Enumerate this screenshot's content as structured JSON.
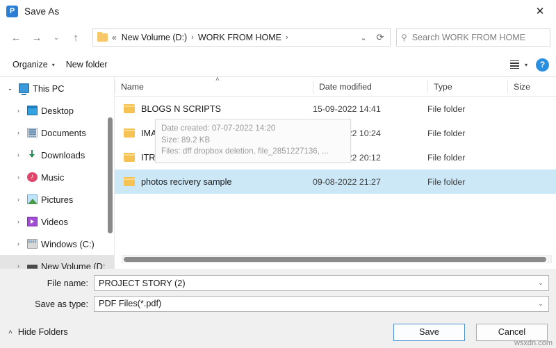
{
  "window": {
    "title": "Save As",
    "app_icon": "pdf-app-icon",
    "app_icon_letter": "P",
    "app_icon_color": "#2b7fd4",
    "close_label": "✕"
  },
  "nav": {
    "back": "←",
    "forward": "→",
    "recent": "⌄",
    "up": "↑"
  },
  "address": {
    "leading": "«",
    "crumbs": [
      "New Volume (D:)",
      "WORK FROM HOME"
    ],
    "separator": "›",
    "dropdown": "⌄",
    "refresh": "⟳"
  },
  "search": {
    "placeholder": "Search WORK FROM HOME",
    "value": "",
    "icon": "search-icon"
  },
  "commandbar": {
    "organize": "Organize",
    "organize_caret": "▾",
    "new_folder": "New folder",
    "view_caret": "▾",
    "help": "?"
  },
  "sidebar": {
    "items": [
      {
        "label": "This PC",
        "twisty": "⌄",
        "expanded": true,
        "icon": "monitor-icon",
        "icon_class": "ic-pc",
        "indent": false,
        "selected": false
      },
      {
        "label": "Desktop",
        "twisty": "›",
        "expanded": false,
        "icon": "desktop-icon",
        "icon_class": "ic-desktop",
        "indent": true,
        "selected": false
      },
      {
        "label": "Documents",
        "twisty": "›",
        "expanded": false,
        "icon": "documents-icon",
        "icon_class": "ic-doc",
        "indent": true,
        "selected": false
      },
      {
        "label": "Downloads",
        "twisty": "›",
        "expanded": false,
        "icon": "downloads-icon",
        "icon_class": "ic-dl",
        "indent": true,
        "selected": false
      },
      {
        "label": "Music",
        "twisty": "›",
        "expanded": false,
        "icon": "music-icon",
        "icon_class": "ic-music",
        "indent": true,
        "selected": false
      },
      {
        "label": "Pictures",
        "twisty": "›",
        "expanded": false,
        "icon": "pictures-icon",
        "icon_class": "ic-pic",
        "indent": true,
        "selected": false
      },
      {
        "label": "Videos",
        "twisty": "›",
        "expanded": false,
        "icon": "videos-icon",
        "icon_class": "ic-vid",
        "indent": true,
        "selected": false
      },
      {
        "label": "Windows (C:)",
        "twisty": "›",
        "expanded": false,
        "icon": "drive-icon",
        "icon_class": "ic-drive-c",
        "indent": true,
        "selected": false
      },
      {
        "label": "New Volume (D:",
        "twisty": "›",
        "expanded": false,
        "icon": "drive-icon",
        "icon_class": "ic-drive",
        "indent": true,
        "selected": true
      }
    ]
  },
  "filelist": {
    "columns": [
      "Name",
      "Date modified",
      "Type",
      "Size"
    ],
    "sort_caret": "˄",
    "rows": [
      {
        "name": "BLOGS N SCRIPTS",
        "date": "15-09-2022 14:41",
        "type": "File folder",
        "size": "",
        "selected": false
      },
      {
        "name": "IMAGES",
        "date": "21-09-2022 10:24",
        "type": "File folder",
        "size": "",
        "selected": false
      },
      {
        "name": "ITR Declaration",
        "date": "29-06-2022 20:12",
        "type": "File folder",
        "size": "",
        "selected": false
      },
      {
        "name": "photos recivery sample",
        "date": "09-08-2022 21:27",
        "type": "File folder",
        "size": "",
        "selected": true
      }
    ],
    "tooltip": {
      "line1": "Date created: 07-07-2022 14:20",
      "line2": "Size: 89.2 KB",
      "line3": "Files: dff dropbox deletion, file_2851227136, ..."
    }
  },
  "form": {
    "filename_label": "File name:",
    "filename_value": "PROJECT STORY (2)",
    "savetype_label": "Save as type:",
    "savetype_value": "PDF Files(*.pdf)",
    "caret": "⌄"
  },
  "footer": {
    "hide_folders": "Hide Folders",
    "hide_caret": "˄",
    "save": "Save",
    "cancel": "Cancel",
    "watermark": "wsxdn.com"
  }
}
